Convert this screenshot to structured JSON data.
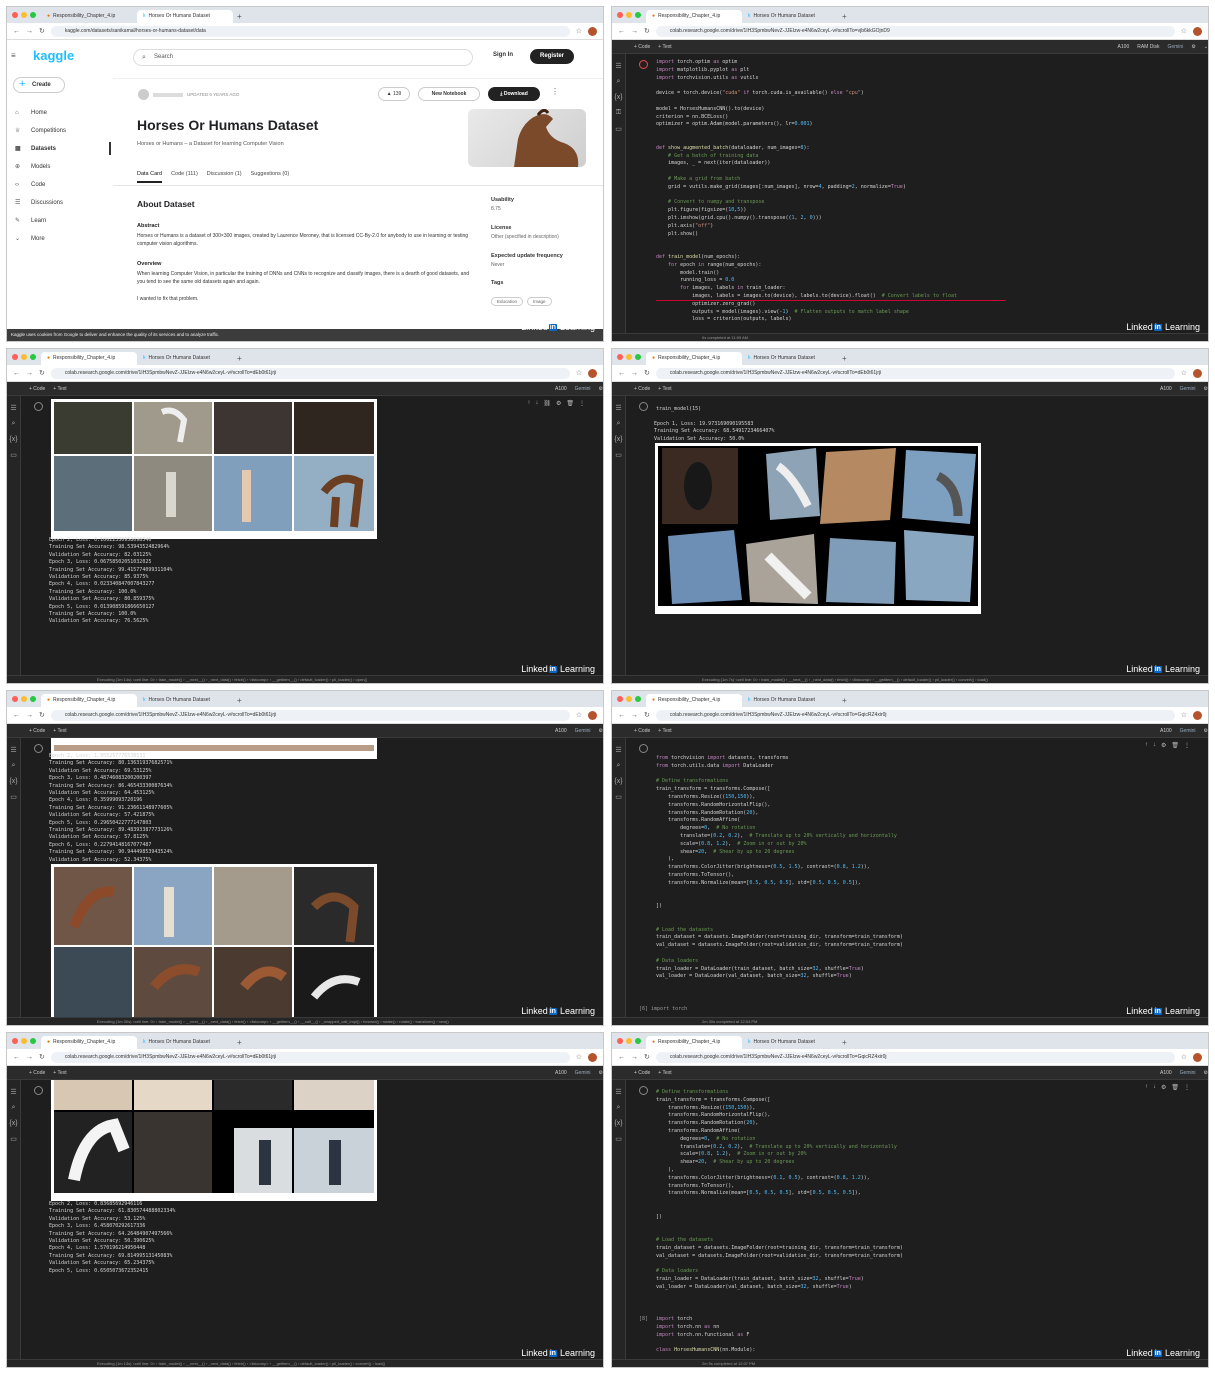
{
  "browser": {
    "tab1": "Responsibility_Chapter_4.ip",
    "tab2": "Horses Or Humans Dataset",
    "kaggle_url": "kaggle.com/datasets/sanikamal/horses-or-humans-dataset/data",
    "colab_url_a": "colab.research.google.com/drive/1IH3SpmbwNevZ-JJEIzw-e4N6w2ceyL-v#scrollTo=vjb6kkGOjnD9",
    "colab_url_b": "colab.research.google.com/drive/1IH3SpmbwNevZ-JJEIzw-e4N6w2ceyL-v#scrollTo=dEb0t61jrji",
    "colab_url_c": "colab.research.google.com/drive/1IH3SpmbwNevZ-JJEIzw-e4N6w2ceyL-v#scrollTo=GqicRZ4xir0j"
  },
  "kaggle": {
    "logo": "kaggle",
    "create": "Create",
    "nav": [
      "Home",
      "Competitions",
      "Datasets",
      "Models",
      "Code",
      "Discussions",
      "Learn",
      "More"
    ],
    "search_placeholder": "Search",
    "sign_in": "Sign In",
    "register": "Register",
    "updated": "UPDATED 6 YEARS AGO",
    "votes": "139",
    "new_notebook": "New Notebook",
    "download": "Download",
    "title": "Horses Or Humans Dataset",
    "subtitle": "Horses or Humans – a Dataset for learning Computer Vision",
    "tabs": [
      "Data Card",
      "Code (111)",
      "Discussion (1)",
      "Suggestions (0)"
    ],
    "about": "About Dataset",
    "abstract_h": "Abstract",
    "abstract": "Horses or Humans is a dataset of 300×300 images, created by Laurence Moroney, that is licensed CC-By-2.0 for anybody to use in learning or testing computer vision algorithms.",
    "overview_h": "Overview",
    "overview": "When learning Computer Vision, in particular the training of DNNs and CNNs to recognize and classify images, there is a dearth of good datasets, and you tend to see the same old datasets again and again.",
    "wanted": "I wanted to fix that problem.",
    "usability_h": "Usability",
    "usability": "8.75",
    "license_h": "License",
    "license": "Other (specified in description)",
    "freq_h": "Expected update frequency",
    "freq": "Never",
    "tags_h": "Tags",
    "tag1": "Education",
    "tag2": "Image",
    "cookie": "Kaggle uses cookies from Google to deliver and enhance the quality of its services and to analyze traffic."
  },
  "colab": {
    "code_btn": "+ Code",
    "text_btn": "+ Text",
    "gemini": "Gemini",
    "gpu": "A100",
    "ram": "RAM Disk",
    "linkedin": "Linked",
    "linkedin_b": "in",
    "learning": "Learning",
    "status_done_1": "0s   completed at 11:59 AM",
    "status_done_2": "2m 30s   completed at 12:04 PM",
    "status_done_3": "2m 5s   completed at 12:07 PM",
    "status_exec_1": "Executing (1m 14s) <cell line: 0> › train_model() › __next__() › _next_data() › fetch() › <listcomp> › __getitem__() › default_loader() › pil_loader() › open()",
    "status_exec_2": "Executing (1m 7s) <cell line: 0> › train_model() › __next__() › _next_data() › fetch() › <listcomp> › __getitem__() › default_loader() › pil_loader() › convert() › load()",
    "status_exec_3": "Executing (1m 30s) <cell line: 0> › train_model() › __next__() › _next_data() › fetch() › <listcomp> › __getitem__() › __call__() › _wrapped_call_impl() › forward() › rotate() › rotate() › transform() › new()",
    "status_exec_4": "Executing (1m 13s) <cell line: 0> › train_model() › __next__() › _next_data() › fetch() › <listcomp> › __getitem__() › default_loader() › pil_loader() › convert() › load()",
    "p4_call": "train_model(15)",
    "cell6": "[6]  import torch",
    "cell8": "[8]",
    "log_p3": "Epoch 2, Loss: 0.10622330958098546\nTraining Set Accuracy: 98.5394352482964%\nValidation Set Accuracy: 82.03125%\nEpoch 3, Loss: 0.06758502051032025\nTraining Set Accuracy: 99.41577409931104%\nValidation Set Accuracy: 85.9375%\nEpoch 4, Loss: 0.023340847007843277\nTraining Set Accuracy: 100.0%\nValidation Set Accuracy: 80.859375%\nEpoch 5, Loss: 0.013908591866650127\nTraining Set Accuracy: 100.0%\nValidation Set Accuracy: 76.5625%",
    "log_p4": "Epoch 1, Loss: 19.973169090195583\nTraining Set Accuracy: 68.5491723466407%\nValidation Set Accuracy: 50.0%",
    "log_p5": "Epoch 2, Loss: 1.955257776538531\nTraining Set Accuracy: 80.13631937682571%\nValidation Set Accuracy: 69.53125%\nEpoch 3, Loss: 0.48746083200200397\nTraining Set Accuracy: 86.46543330087634%\nValidation Set Accuracy: 64.453125%\nEpoch 4, Loss: 0.35999093720196\nTraining Set Accuracy: 91.23661148977605%\nValidation Set Accuracy: 57.421875%\nEpoch 5, Loss: 0.29650422777147803\nTraining Set Accuracy: 89.48393387773126%\nValidation Set Accuracy: 57.8125%\nEpoch 6, Loss: 0.22794148167077487\nTraining Set Accuracy: 90.94449853943524%\nValidation Set Accuracy: 52.34375%",
    "log_p7": "Epoch 2, Loss: 0.83685692946116\nTraining Set Accuracy: 61.830574488802334%\nValidation Set Accuracy: 53.125%\nEpoch 3, Loss: 6.458070292617336\nTraining Set Accuracy: 64.26484907497566%\nValidation Set Accuracy: 50.390625%\nEpoch 4, Loss: 1.570196214950448\nTraining Set Accuracy: 69.81499513145083%\nValidation Set Accuracy: 65.234375%\nEpoch 5, Loss: 0.6505073672352415"
  }
}
